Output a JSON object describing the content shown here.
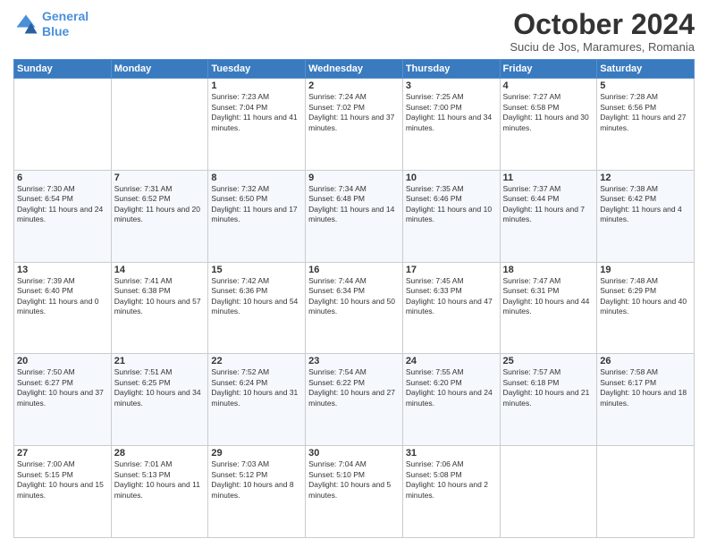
{
  "header": {
    "logo_line1": "General",
    "logo_line2": "Blue",
    "month": "October 2024",
    "location": "Suciu de Jos, Maramures, Romania"
  },
  "weekdays": [
    "Sunday",
    "Monday",
    "Tuesday",
    "Wednesday",
    "Thursday",
    "Friday",
    "Saturday"
  ],
  "weeks": [
    [
      {
        "day": "",
        "info": ""
      },
      {
        "day": "",
        "info": ""
      },
      {
        "day": "1",
        "info": "Sunrise: 7:23 AM\nSunset: 7:04 PM\nDaylight: 11 hours and 41 minutes."
      },
      {
        "day": "2",
        "info": "Sunrise: 7:24 AM\nSunset: 7:02 PM\nDaylight: 11 hours and 37 minutes."
      },
      {
        "day": "3",
        "info": "Sunrise: 7:25 AM\nSunset: 7:00 PM\nDaylight: 11 hours and 34 minutes."
      },
      {
        "day": "4",
        "info": "Sunrise: 7:27 AM\nSunset: 6:58 PM\nDaylight: 11 hours and 30 minutes."
      },
      {
        "day": "5",
        "info": "Sunrise: 7:28 AM\nSunset: 6:56 PM\nDaylight: 11 hours and 27 minutes."
      }
    ],
    [
      {
        "day": "6",
        "info": "Sunrise: 7:30 AM\nSunset: 6:54 PM\nDaylight: 11 hours and 24 minutes."
      },
      {
        "day": "7",
        "info": "Sunrise: 7:31 AM\nSunset: 6:52 PM\nDaylight: 11 hours and 20 minutes."
      },
      {
        "day": "8",
        "info": "Sunrise: 7:32 AM\nSunset: 6:50 PM\nDaylight: 11 hours and 17 minutes."
      },
      {
        "day": "9",
        "info": "Sunrise: 7:34 AM\nSunset: 6:48 PM\nDaylight: 11 hours and 14 minutes."
      },
      {
        "day": "10",
        "info": "Sunrise: 7:35 AM\nSunset: 6:46 PM\nDaylight: 11 hours and 10 minutes."
      },
      {
        "day": "11",
        "info": "Sunrise: 7:37 AM\nSunset: 6:44 PM\nDaylight: 11 hours and 7 minutes."
      },
      {
        "day": "12",
        "info": "Sunrise: 7:38 AM\nSunset: 6:42 PM\nDaylight: 11 hours and 4 minutes."
      }
    ],
    [
      {
        "day": "13",
        "info": "Sunrise: 7:39 AM\nSunset: 6:40 PM\nDaylight: 11 hours and 0 minutes."
      },
      {
        "day": "14",
        "info": "Sunrise: 7:41 AM\nSunset: 6:38 PM\nDaylight: 10 hours and 57 minutes."
      },
      {
        "day": "15",
        "info": "Sunrise: 7:42 AM\nSunset: 6:36 PM\nDaylight: 10 hours and 54 minutes."
      },
      {
        "day": "16",
        "info": "Sunrise: 7:44 AM\nSunset: 6:34 PM\nDaylight: 10 hours and 50 minutes."
      },
      {
        "day": "17",
        "info": "Sunrise: 7:45 AM\nSunset: 6:33 PM\nDaylight: 10 hours and 47 minutes."
      },
      {
        "day": "18",
        "info": "Sunrise: 7:47 AM\nSunset: 6:31 PM\nDaylight: 10 hours and 44 minutes."
      },
      {
        "day": "19",
        "info": "Sunrise: 7:48 AM\nSunset: 6:29 PM\nDaylight: 10 hours and 40 minutes."
      }
    ],
    [
      {
        "day": "20",
        "info": "Sunrise: 7:50 AM\nSunset: 6:27 PM\nDaylight: 10 hours and 37 minutes."
      },
      {
        "day": "21",
        "info": "Sunrise: 7:51 AM\nSunset: 6:25 PM\nDaylight: 10 hours and 34 minutes."
      },
      {
        "day": "22",
        "info": "Sunrise: 7:52 AM\nSunset: 6:24 PM\nDaylight: 10 hours and 31 minutes."
      },
      {
        "day": "23",
        "info": "Sunrise: 7:54 AM\nSunset: 6:22 PM\nDaylight: 10 hours and 27 minutes."
      },
      {
        "day": "24",
        "info": "Sunrise: 7:55 AM\nSunset: 6:20 PM\nDaylight: 10 hours and 24 minutes."
      },
      {
        "day": "25",
        "info": "Sunrise: 7:57 AM\nSunset: 6:18 PM\nDaylight: 10 hours and 21 minutes."
      },
      {
        "day": "26",
        "info": "Sunrise: 7:58 AM\nSunset: 6:17 PM\nDaylight: 10 hours and 18 minutes."
      }
    ],
    [
      {
        "day": "27",
        "info": "Sunrise: 7:00 AM\nSunset: 5:15 PM\nDaylight: 10 hours and 15 minutes."
      },
      {
        "day": "28",
        "info": "Sunrise: 7:01 AM\nSunset: 5:13 PM\nDaylight: 10 hours and 11 minutes."
      },
      {
        "day": "29",
        "info": "Sunrise: 7:03 AM\nSunset: 5:12 PM\nDaylight: 10 hours and 8 minutes."
      },
      {
        "day": "30",
        "info": "Sunrise: 7:04 AM\nSunset: 5:10 PM\nDaylight: 10 hours and 5 minutes."
      },
      {
        "day": "31",
        "info": "Sunrise: 7:06 AM\nSunset: 5:08 PM\nDaylight: 10 hours and 2 minutes."
      },
      {
        "day": "",
        "info": ""
      },
      {
        "day": "",
        "info": ""
      }
    ]
  ]
}
